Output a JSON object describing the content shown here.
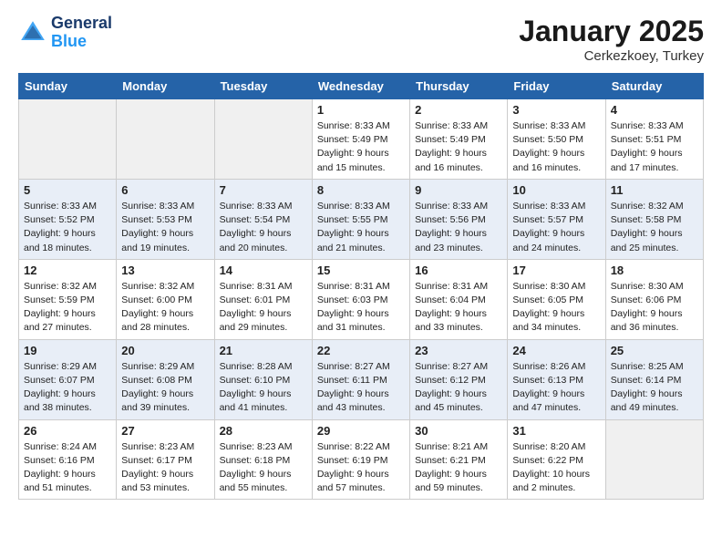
{
  "header": {
    "logo_line1": "General",
    "logo_line2": "Blue",
    "month": "January 2025",
    "location": "Cerkezkoey, Turkey"
  },
  "weekdays": [
    "Sunday",
    "Monday",
    "Tuesday",
    "Wednesday",
    "Thursday",
    "Friday",
    "Saturday"
  ],
  "weeks": [
    [
      {
        "day": "",
        "info": ""
      },
      {
        "day": "",
        "info": ""
      },
      {
        "day": "",
        "info": ""
      },
      {
        "day": "1",
        "info": "Sunrise: 8:33 AM\nSunset: 5:49 PM\nDaylight: 9 hours\nand 15 minutes."
      },
      {
        "day": "2",
        "info": "Sunrise: 8:33 AM\nSunset: 5:49 PM\nDaylight: 9 hours\nand 16 minutes."
      },
      {
        "day": "3",
        "info": "Sunrise: 8:33 AM\nSunset: 5:50 PM\nDaylight: 9 hours\nand 16 minutes."
      },
      {
        "day": "4",
        "info": "Sunrise: 8:33 AM\nSunset: 5:51 PM\nDaylight: 9 hours\nand 17 minutes."
      }
    ],
    [
      {
        "day": "5",
        "info": "Sunrise: 8:33 AM\nSunset: 5:52 PM\nDaylight: 9 hours\nand 18 minutes."
      },
      {
        "day": "6",
        "info": "Sunrise: 8:33 AM\nSunset: 5:53 PM\nDaylight: 9 hours\nand 19 minutes."
      },
      {
        "day": "7",
        "info": "Sunrise: 8:33 AM\nSunset: 5:54 PM\nDaylight: 9 hours\nand 20 minutes."
      },
      {
        "day": "8",
        "info": "Sunrise: 8:33 AM\nSunset: 5:55 PM\nDaylight: 9 hours\nand 21 minutes."
      },
      {
        "day": "9",
        "info": "Sunrise: 8:33 AM\nSunset: 5:56 PM\nDaylight: 9 hours\nand 23 minutes."
      },
      {
        "day": "10",
        "info": "Sunrise: 8:33 AM\nSunset: 5:57 PM\nDaylight: 9 hours\nand 24 minutes."
      },
      {
        "day": "11",
        "info": "Sunrise: 8:32 AM\nSunset: 5:58 PM\nDaylight: 9 hours\nand 25 minutes."
      }
    ],
    [
      {
        "day": "12",
        "info": "Sunrise: 8:32 AM\nSunset: 5:59 PM\nDaylight: 9 hours\nand 27 minutes."
      },
      {
        "day": "13",
        "info": "Sunrise: 8:32 AM\nSunset: 6:00 PM\nDaylight: 9 hours\nand 28 minutes."
      },
      {
        "day": "14",
        "info": "Sunrise: 8:31 AM\nSunset: 6:01 PM\nDaylight: 9 hours\nand 29 minutes."
      },
      {
        "day": "15",
        "info": "Sunrise: 8:31 AM\nSunset: 6:03 PM\nDaylight: 9 hours\nand 31 minutes."
      },
      {
        "day": "16",
        "info": "Sunrise: 8:31 AM\nSunset: 6:04 PM\nDaylight: 9 hours\nand 33 minutes."
      },
      {
        "day": "17",
        "info": "Sunrise: 8:30 AM\nSunset: 6:05 PM\nDaylight: 9 hours\nand 34 minutes."
      },
      {
        "day": "18",
        "info": "Sunrise: 8:30 AM\nSunset: 6:06 PM\nDaylight: 9 hours\nand 36 minutes."
      }
    ],
    [
      {
        "day": "19",
        "info": "Sunrise: 8:29 AM\nSunset: 6:07 PM\nDaylight: 9 hours\nand 38 minutes."
      },
      {
        "day": "20",
        "info": "Sunrise: 8:29 AM\nSunset: 6:08 PM\nDaylight: 9 hours\nand 39 minutes."
      },
      {
        "day": "21",
        "info": "Sunrise: 8:28 AM\nSunset: 6:10 PM\nDaylight: 9 hours\nand 41 minutes."
      },
      {
        "day": "22",
        "info": "Sunrise: 8:27 AM\nSunset: 6:11 PM\nDaylight: 9 hours\nand 43 minutes."
      },
      {
        "day": "23",
        "info": "Sunrise: 8:27 AM\nSunset: 6:12 PM\nDaylight: 9 hours\nand 45 minutes."
      },
      {
        "day": "24",
        "info": "Sunrise: 8:26 AM\nSunset: 6:13 PM\nDaylight: 9 hours\nand 47 minutes."
      },
      {
        "day": "25",
        "info": "Sunrise: 8:25 AM\nSunset: 6:14 PM\nDaylight: 9 hours\nand 49 minutes."
      }
    ],
    [
      {
        "day": "26",
        "info": "Sunrise: 8:24 AM\nSunset: 6:16 PM\nDaylight: 9 hours\nand 51 minutes."
      },
      {
        "day": "27",
        "info": "Sunrise: 8:23 AM\nSunset: 6:17 PM\nDaylight: 9 hours\nand 53 minutes."
      },
      {
        "day": "28",
        "info": "Sunrise: 8:23 AM\nSunset: 6:18 PM\nDaylight: 9 hours\nand 55 minutes."
      },
      {
        "day": "29",
        "info": "Sunrise: 8:22 AM\nSunset: 6:19 PM\nDaylight: 9 hours\nand 57 minutes."
      },
      {
        "day": "30",
        "info": "Sunrise: 8:21 AM\nSunset: 6:21 PM\nDaylight: 9 hours\nand 59 minutes."
      },
      {
        "day": "31",
        "info": "Sunrise: 8:20 AM\nSunset: 6:22 PM\nDaylight: 10 hours\nand 2 minutes."
      },
      {
        "day": "",
        "info": ""
      }
    ]
  ]
}
